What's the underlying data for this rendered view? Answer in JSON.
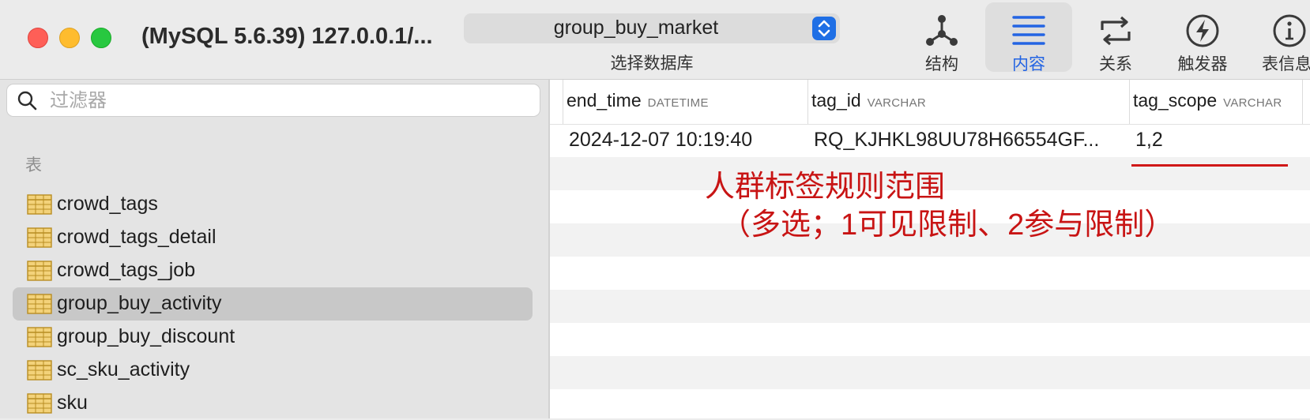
{
  "window": {
    "title": "(MySQL 5.6.39) 127.0.0.1/..."
  },
  "toolbar": {
    "database_select": {
      "value": "group_buy_market",
      "caption": "选择数据库"
    },
    "buttons": [
      {
        "label": "结构",
        "icon": "structure-icon",
        "active": false
      },
      {
        "label": "内容",
        "icon": "content-list-icon",
        "active": true
      },
      {
        "label": "关系",
        "icon": "relations-icon",
        "active": false
      },
      {
        "label": "触发器",
        "icon": "trigger-bolt-icon",
        "active": false
      },
      {
        "label": "表信息",
        "icon": "info-icon",
        "active": false
      }
    ]
  },
  "sidebar": {
    "filter_placeholder": "过滤器",
    "section_title": "表",
    "tables": [
      {
        "name": "crowd_tags",
        "selected": false
      },
      {
        "name": "crowd_tags_detail",
        "selected": false
      },
      {
        "name": "crowd_tags_job",
        "selected": false
      },
      {
        "name": "group_buy_activity",
        "selected": true
      },
      {
        "name": "group_buy_discount",
        "selected": false
      },
      {
        "name": "sc_sku_activity",
        "selected": false
      },
      {
        "name": "sku",
        "selected": false
      }
    ]
  },
  "grid": {
    "columns": [
      {
        "name": "end_time",
        "type": "DATETIME"
      },
      {
        "name": "tag_id",
        "type": "VARCHAR"
      },
      {
        "name": "tag_scope",
        "type": "VARCHAR"
      }
    ],
    "rows": [
      [
        "2024-12-07 10:19:40",
        "RQ_KJHKL98UU78H66554GF...",
        "1,2"
      ]
    ]
  },
  "annotation": {
    "line1": "人群标签规则范围",
    "line2": "（多选；1可见限制、2参与限制）",
    "color": "#c81414"
  }
}
